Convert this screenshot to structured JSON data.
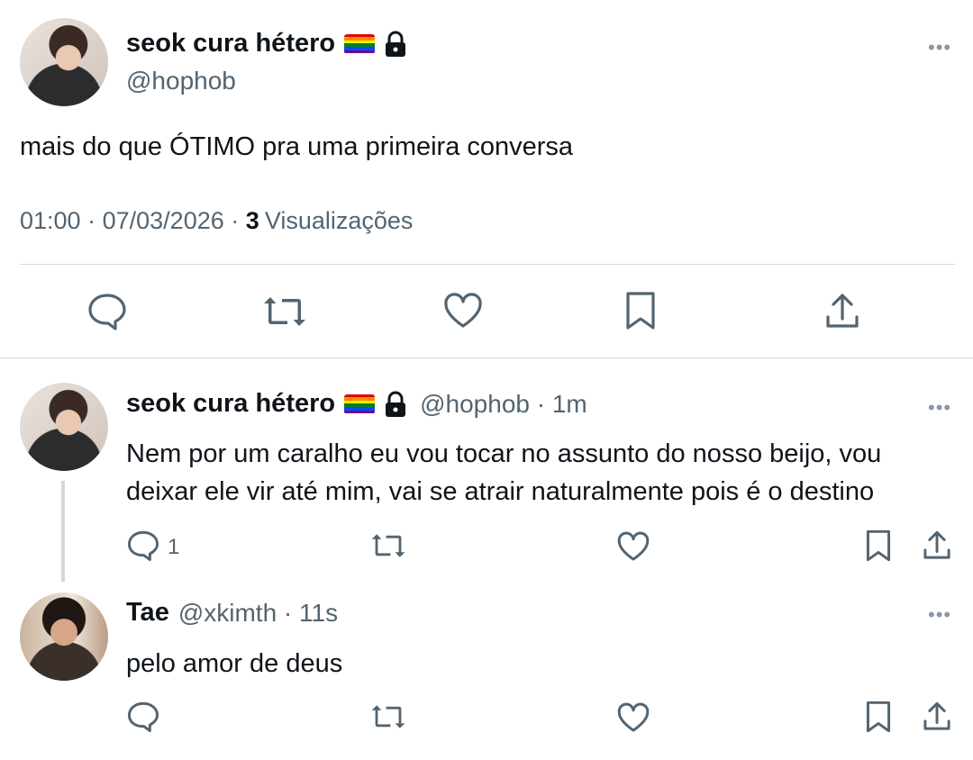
{
  "main_tweet": {
    "display_name": "seok cura hétero",
    "handle": "@hophob",
    "text": "mais do que ÓTIMO pra uma primeira conversa",
    "time": "01:00",
    "sep1": "·",
    "date": "07/03/2026",
    "sep2": "·",
    "views_count": "3",
    "views_label": "Visualizações",
    "more_label": "•••"
  },
  "reply1": {
    "display_name": "seok cura hétero",
    "handle_time": "@hophob · 1m",
    "text_line1": "Nem por um caralho eu vou tocar no assunto do nosso beijo, vou",
    "text_line2": "deixar ele vir até mim, vai se atrair naturalmente pois é o destino",
    "reply_count": "1",
    "more_label": "•••"
  },
  "reply2": {
    "display_name": "Tae",
    "handle_time": "@xkimth · 11s",
    "text": "pelo amor de deus",
    "more_label": "•••"
  },
  "icons": {
    "reply": "reply-icon",
    "retweet": "retweet-icon",
    "like": "heart-icon",
    "bookmark": "bookmark-icon",
    "share": "share-icon",
    "lock": "lock-icon",
    "flag": "rainbow-flag-icon"
  },
  "colors": {
    "text": "#0f1419",
    "secondary": "#536471",
    "divider": "#cfd9de",
    "thread_line": "#cfd9de"
  }
}
